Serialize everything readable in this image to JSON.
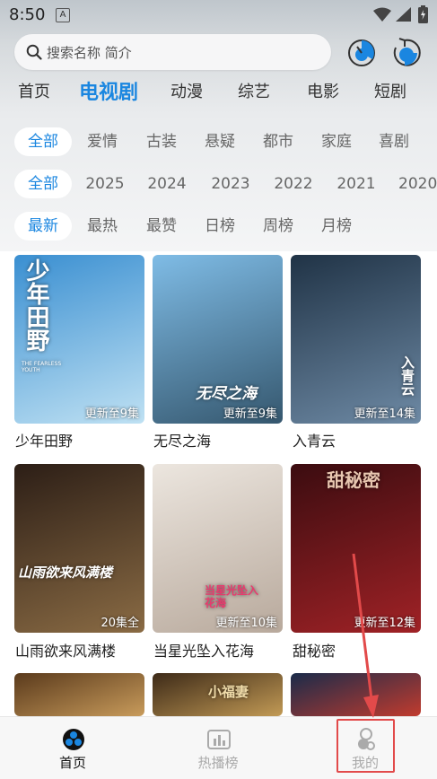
{
  "status_bar": {
    "time": "8:50",
    "notification_icon": "A"
  },
  "search": {
    "placeholder": "搜索名称 简介"
  },
  "header_icons": [
    "history-icon",
    "timer-icon"
  ],
  "categories": [
    {
      "label": "首页",
      "active": false
    },
    {
      "label": "电视剧",
      "active": true
    },
    {
      "label": "动漫",
      "active": false
    },
    {
      "label": "综艺",
      "active": false
    },
    {
      "label": "电影",
      "active": false
    },
    {
      "label": "短剧",
      "active": false
    }
  ],
  "genres": [
    "全部",
    "爱情",
    "古装",
    "悬疑",
    "都市",
    "家庭",
    "喜剧"
  ],
  "years": [
    "全部",
    "2025",
    "2024",
    "2023",
    "2022",
    "2021",
    "2020"
  ],
  "sorts": [
    "最新",
    "最热",
    "最赞",
    "日榜",
    "周榜",
    "月榜"
  ],
  "posters": [
    {
      "title": "少年田野",
      "badge": "更新至9集",
      "art_text": "少年田野",
      "art_sub": "THE FEARLESS YOUTH",
      "colors": [
        "#3a8fd1",
        "#bfe1f3"
      ]
    },
    {
      "title": "无尽之海",
      "badge": "更新至9集",
      "art_text": "无尽之海",
      "colors": [
        "#7fbce6",
        "#35576e"
      ]
    },
    {
      "title": "入青云",
      "badge": "更新至14集",
      "art_text": "入青云",
      "colors": [
        "#203346",
        "#6e8aa5"
      ]
    },
    {
      "title": "山雨欲来风满楼",
      "badge": "20集全",
      "art_text": "山雨欲来风满楼",
      "colors": [
        "#2c1e16",
        "#8a6b44"
      ]
    },
    {
      "title": "当星光坠入花海",
      "badge": "更新至10集",
      "art_text": "当星光坠入花海",
      "colors": [
        "#ece6df",
        "#b8a99c"
      ]
    },
    {
      "title": "甜秘密",
      "badge": "更新至12集",
      "art_text": "甜秘密",
      "colors": [
        "#3b0c10",
        "#a02226"
      ]
    },
    {
      "title": "",
      "badge": "",
      "colors": [
        "#5a3a1c",
        "#c89b5b"
      ]
    },
    {
      "title": "",
      "badge": "",
      "art_text": "小福妻",
      "colors": [
        "#3d2a18",
        "#c29a55"
      ]
    },
    {
      "title": "",
      "badge": "",
      "colors": [
        "#1a2b4a",
        "#c13b2e"
      ]
    }
  ],
  "tabs": [
    {
      "label": "首页",
      "icon": "home-icon",
      "active": true
    },
    {
      "label": "热播榜",
      "icon": "chart-icon",
      "active": false
    },
    {
      "label": "我的",
      "icon": "profile-icon",
      "active": false
    }
  ],
  "colors": {
    "accent": "#1a86e0",
    "highlight": "#e24a4a"
  }
}
